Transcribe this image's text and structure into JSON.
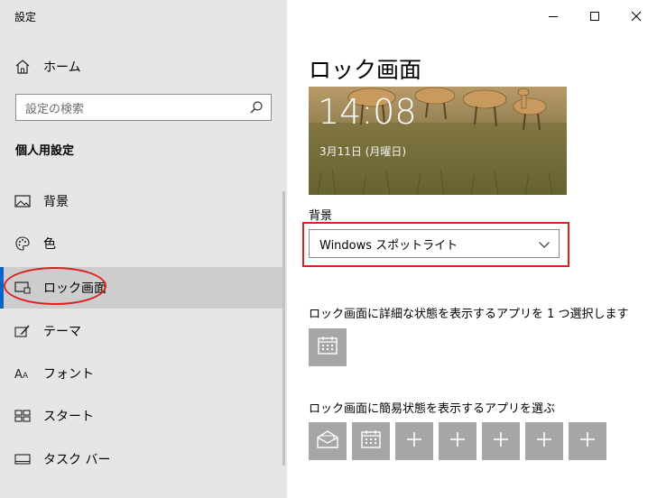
{
  "window": {
    "title": "設定",
    "minimize_label": "Minimize",
    "maximize_label": "Maximize",
    "close_label": "Close"
  },
  "sidebar": {
    "home_label": "ホーム",
    "search_placeholder": "設定の検索",
    "section_title": "個人用設定",
    "items": [
      {
        "label": "背景",
        "icon": "picture-icon"
      },
      {
        "label": "色",
        "icon": "palette-icon"
      },
      {
        "label": "ロック画面",
        "icon": "lock-screen-icon",
        "active": true
      },
      {
        "label": "テーマ",
        "icon": "theme-brush-icon"
      },
      {
        "label": "フォント",
        "icon": "font-icon"
      },
      {
        "label": "スタート",
        "icon": "start-grid-icon"
      },
      {
        "label": "タスク バー",
        "icon": "taskbar-icon"
      }
    ]
  },
  "main": {
    "title": "ロック画面",
    "preview": {
      "time": "14:08",
      "date": "3月11日 (月曜日)"
    },
    "background_label": "背景",
    "background_value": "Windows スポットライト",
    "detail_label": "ロック画面に詳細な状態を表示するアプリを 1 つ選択します",
    "quick_label": "ロック画面に簡易状態を表示するアプリを選ぶ"
  },
  "colors": {
    "accent": "#0a64c8",
    "highlight_red": "#e02020",
    "tile_gray": "#a6a6a6",
    "sidebar_bg": "#e6e6e6"
  }
}
